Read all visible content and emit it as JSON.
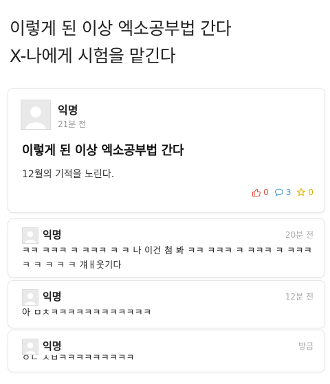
{
  "caption": {
    "line1": "이렇게 된 이상 엑소공부법 간다",
    "line2": "X-나에게 시험을 맡긴다"
  },
  "post": {
    "author": "익명",
    "time": "21분 전",
    "title": "이렇게 된 이상 엑소공부법 간다",
    "body": "12월의 기적을 노린다.",
    "likes": "0",
    "comments": "3",
    "scraps": "0"
  },
  "comments": [
    {
      "author": "익명",
      "time": "20분 전",
      "text": "ㅋㅋ ㅋㅋㅋ ㅋ ㅋㅋㅋ ㅋ ㅋ 나 이건 첨 봐 ㅋㅋ ㅋㅋㅋ ㅋ ㅋㅋㅋ ㅋ ㅋㅋㅋ ㅋ ㅋ ㅋ ㅋ ㅋ 걔ㅐ웃기다"
    },
    {
      "author": "익명",
      "time": "12분 전",
      "text": "아 ㅁㅊㅋㅋㅋㅋㅋㅋㅋㅋㅋㅋㅋㅋ"
    },
    {
      "author": "익명",
      "time": "방금",
      "text": "ㅇㄴ ㅅㅂㅋㅋㅋㅋㅋㅋㅋㅋㅋ"
    }
  ],
  "colors": {
    "like": "#e05040",
    "comment": "#3a9ad9",
    "scrap": "#e0b000"
  },
  "icons": {
    "like": "thumbs-up-icon",
    "comment": "speech-bubble-icon",
    "scrap": "star-icon",
    "avatar": "default-user-icon"
  }
}
